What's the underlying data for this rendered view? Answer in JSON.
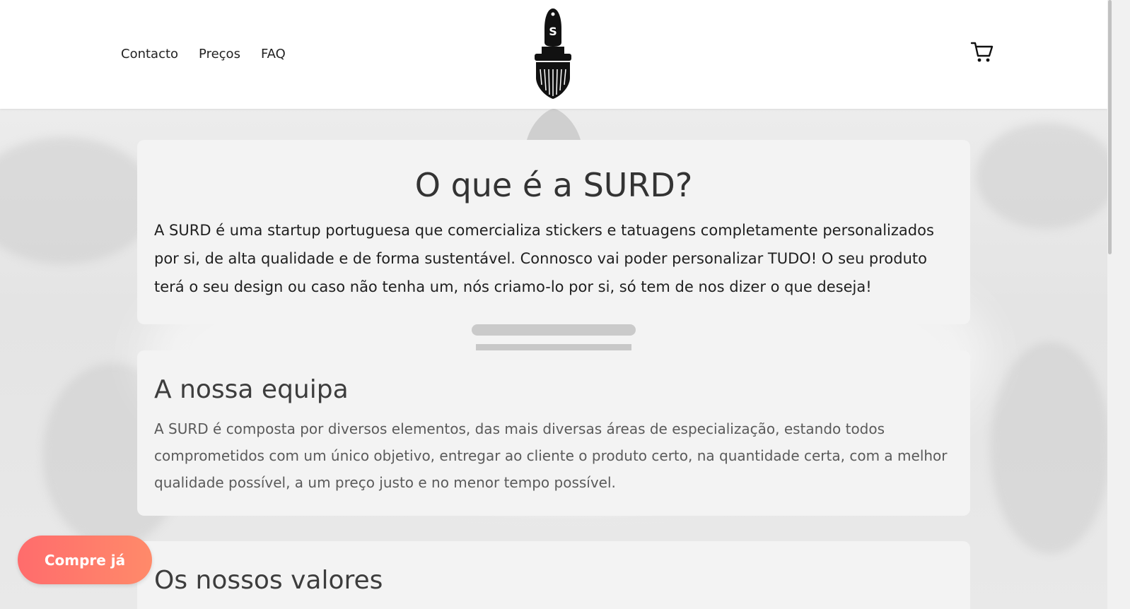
{
  "nav": {
    "items": [
      {
        "label": "Contacto"
      },
      {
        "label": "Preços"
      },
      {
        "label": "FAQ"
      }
    ]
  },
  "logo": {
    "letter": "S"
  },
  "icons": {
    "cart": "shopping-cart-icon",
    "logo": "paintbrush-logo-icon"
  },
  "sections": {
    "about": {
      "title": "O que é a SURD?",
      "body": "A SURD é uma startup portuguesa que comercializa stickers e tatuagens completamente personalizados por si, de alta qualidade e de forma sustentável. Connosco vai poder personalizar TUDO! O seu produto terá o seu design ou caso não tenha um, nós criamo-lo por si, só tem de nos dizer o que deseja!"
    },
    "team": {
      "title": "A nossa equipa",
      "body": "A SURD é composta por diversos elementos, das mais diversas áreas de especialização, estando todos comprometidos com um único objetivo, entregar ao cliente o produto certo, na quantidade certa, com a melhor qualidade possível, a um preço justo e no menor tempo possível."
    },
    "values": {
      "title": "Os nossos valores"
    }
  },
  "cta": {
    "label": "Compre já"
  },
  "colors": {
    "accent_start": "#ff6c6c",
    "accent_end": "#ff8a6a",
    "card_bg": "#f3f3f3",
    "text": "#1f1f1f"
  }
}
